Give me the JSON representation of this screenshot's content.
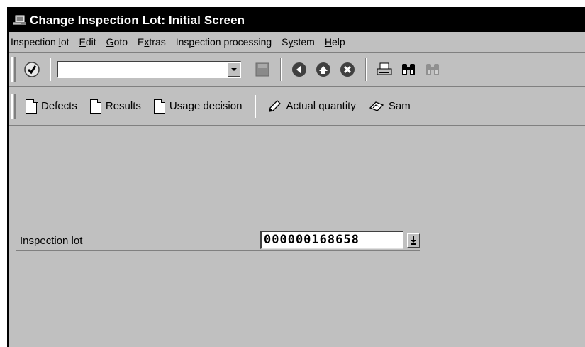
{
  "window": {
    "title": "Change Inspection Lot: Initial Screen"
  },
  "menu": [
    {
      "before": "Inspection ",
      "key": "l",
      "after": "ot"
    },
    {
      "before": "",
      "key": "E",
      "after": "dit"
    },
    {
      "before": "",
      "key": "G",
      "after": "oto"
    },
    {
      "before": "E",
      "key": "x",
      "after": "tras"
    },
    {
      "before": "Ins",
      "key": "p",
      "after": "ection processing"
    },
    {
      "before": "S",
      "key": "y",
      "after": "stem"
    },
    {
      "before": "",
      "key": "H",
      "after": "elp"
    }
  ],
  "standard_toolbar": {
    "command_field": {
      "value": ""
    },
    "icons": [
      "enter-icon",
      "save-icon",
      "back-icon",
      "exit-icon",
      "cancel-icon",
      "print-icon",
      "find-icon",
      "find-next-icon"
    ]
  },
  "app_toolbar": {
    "defects": "Defects",
    "results": "Results",
    "usage_decision": "Usage decision",
    "actual_quantity": "Actual quantity",
    "sample": "Sam"
  },
  "form": {
    "inspection_lot_label": "Inspection lot",
    "inspection_lot_value": "000000168658"
  }
}
